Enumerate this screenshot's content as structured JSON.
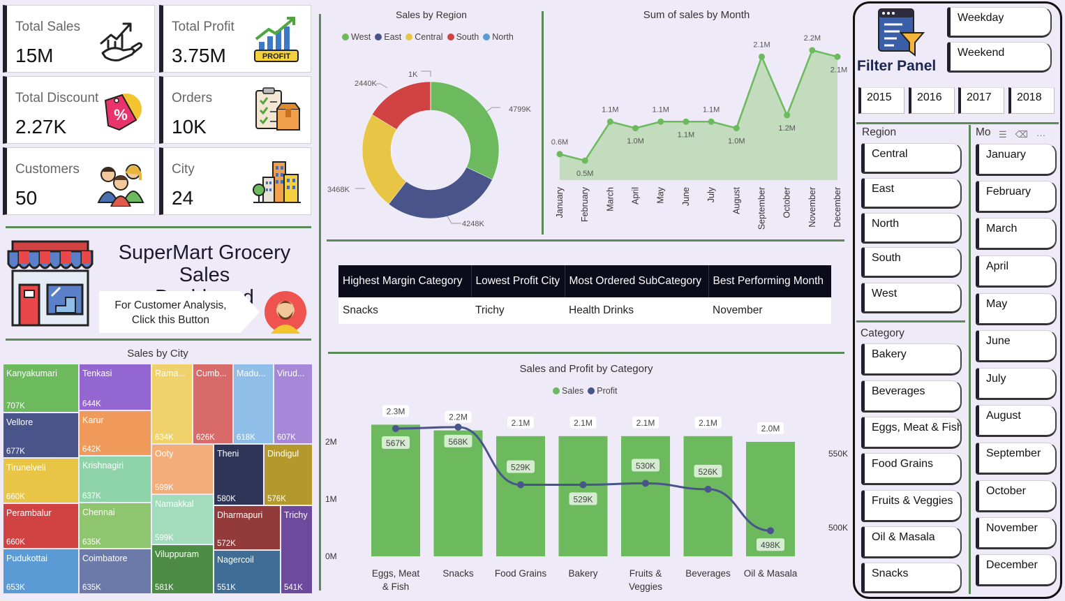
{
  "kpis": [
    {
      "label": "Total Sales",
      "value": "15M",
      "icon": "money-hand-chart-icon"
    },
    {
      "label": "Total Profit",
      "value": "3.75M",
      "icon": "profit-chart-icon"
    },
    {
      "label": "Total Discount",
      "value": "2.27K",
      "icon": "discount-tag-icon"
    },
    {
      "label": "Orders",
      "value": "10K",
      "icon": "order-box-icon"
    },
    {
      "label": "Customers",
      "value": "50",
      "icon": "customers-icon"
    },
    {
      "label": "City",
      "value": "24",
      "icon": "city-buildings-icon"
    }
  ],
  "dashboard": {
    "title_line1": "SuperMart Grocery Sales",
    "title_line2": "Dashboard",
    "customer_btn_line1": "For Customer Analysis,",
    "customer_btn_line2": "Click this Button"
  },
  "sales_by_region": {
    "title": "Sales by Region",
    "legend": [
      {
        "name": "West",
        "color": "#6cb95e"
      },
      {
        "name": "East",
        "color": "#49558a"
      },
      {
        "name": "Central",
        "color": "#e9c545"
      },
      {
        "name": "South",
        "color": "#d14343"
      },
      {
        "name": "North",
        "color": "#5b9bd5"
      }
    ],
    "labels": {
      "west": "4799K",
      "east": "4248K",
      "central": "3468K",
      "south": "2440K",
      "north": "1K"
    }
  },
  "sales_by_month": {
    "title": "Sum of sales by Month"
  },
  "kpi_table": {
    "headers": [
      "Highest Margin Category",
      "Lowest Profit City",
      "Most Ordered SubCategory",
      "Best Performing Month"
    ],
    "values": [
      "Snacks",
      "Trichy",
      "Health Drinks",
      "November"
    ]
  },
  "sales_by_city": {
    "title": "Sales by City"
  },
  "sales_profit_category": {
    "title": "Sales and Profit by Category",
    "legend": [
      {
        "name": "Sales",
        "color": "#6cb95e"
      },
      {
        "name": "Profit",
        "color": "#49558a"
      }
    ],
    "y_left_ticks": [
      "2M",
      "1M",
      "0M"
    ],
    "y_right_ticks": [
      "550K",
      "500K"
    ]
  },
  "chart_data": [
    {
      "type": "pie",
      "title": "Sales by Region",
      "categories": [
        "West",
        "East",
        "Central",
        "South",
        "North"
      ],
      "values": [
        4799,
        4248,
        3468,
        2440,
        1
      ],
      "value_labels": [
        "4799K",
        "4248K",
        "3468K",
        "2440K",
        "1K"
      ],
      "donut": true,
      "legend_position": "top"
    },
    {
      "type": "area",
      "title": "Sum of sales by Month",
      "categories": [
        "January",
        "February",
        "March",
        "April",
        "May",
        "June",
        "July",
        "August",
        "September",
        "October",
        "November",
        "December"
      ],
      "values": [
        0.6,
        0.5,
        1.1,
        1.0,
        1.1,
        1.1,
        1.1,
        1.0,
        2.1,
        1.2,
        2.2,
        2.1
      ],
      "value_labels": [
        "0.6M",
        "0.5M",
        "1.1M",
        "1.0M",
        "1.1M",
        "1.1M",
        "1.1M",
        "1.0M",
        "2.1M",
        "1.2M",
        "2.2M",
        "2.1M"
      ],
      "unit": "M"
    },
    {
      "type": "heatmap",
      "title": "Sales by City",
      "categories": [
        "Kanyakumari",
        "Vellore",
        "Tirunelveli",
        "Perambalur",
        "Pudukottai",
        "Tenkasi",
        "Karur",
        "Krishnagiri",
        "Chennai",
        "Coimbatore",
        "Rama...",
        "Cumb...",
        "Madu...",
        "Virud...",
        "Ooty",
        "Theni",
        "Dindigul",
        "Namakkal",
        "Viluppuram",
        "Dharmapuri",
        "Nagercoil",
        "Trichy"
      ],
      "values": [
        707,
        677,
        660,
        660,
        653,
        644,
        642,
        637,
        635,
        635,
        634,
        626,
        618,
        607,
        599,
        580,
        576,
        599,
        581,
        572,
        551,
        541
      ],
      "value_labels": [
        "707K",
        "677K",
        "660K",
        "660K",
        "653K",
        "644K",
        "642K",
        "637K",
        "635K",
        "635K",
        "634K",
        "626K",
        "618K",
        "607K",
        "599K",
        "580K",
        "576K",
        "599K",
        "581K",
        "572K",
        "551K",
        "541K"
      ],
      "colors": [
        "#6cb95e",
        "#49558a",
        "#e9c545",
        "#d14343",
        "#5b9bd5",
        "#9466d1",
        "#ef9a5a",
        "#8fd4a8",
        "#8fc56e",
        "#6b7aa8",
        "#efd26b",
        "#d96a6a",
        "#8fbfe8",
        "#a687d8",
        "#f2ad7a",
        "#2f3557",
        "#b3982e",
        "#a2dcbc",
        "#4c8c45",
        "#933a3a",
        "#3f6d96",
        "#6e4a9c"
      ],
      "subtype": "treemap"
    },
    {
      "type": "bar",
      "title": "Sales and Profit by Category",
      "categories": [
        "Eggs, Meat & Fish",
        "Snacks",
        "Food Grains",
        "Bakery",
        "Fruits & Veggies",
        "Beverages",
        "Oil & Masala"
      ],
      "series": [
        {
          "name": "Sales",
          "type": "bar",
          "values": [
            2.3,
            2.2,
            2.1,
            2.1,
            2.1,
            2.1,
            2.0
          ],
          "labels": [
            "2.3M",
            "2.2M",
            "2.1M",
            "2.1M",
            "2.1M",
            "2.1M",
            "2.0M"
          ],
          "unit": "M"
        },
        {
          "name": "Profit",
          "type": "line",
          "values": [
            567,
            568,
            529,
            529,
            530,
            526,
            498
          ],
          "labels": [
            "567K",
            "568K",
            "529K",
            "529K",
            "530K",
            "526K",
            "498K"
          ],
          "unit": "K"
        }
      ],
      "y_left_ticks": [
        "0M",
        "1M",
        "2M"
      ],
      "y_right_ticks": [
        "500K",
        "550K"
      ],
      "legend_position": "top"
    }
  ],
  "filter_panel": {
    "title": "Filter Panel",
    "day_type": [
      "Weekday",
      "Weekend"
    ],
    "years": [
      "2015",
      "2016",
      "2017",
      "2018"
    ],
    "region_label": "Region",
    "regions": [
      "Central",
      "East",
      "North",
      "South",
      "West"
    ],
    "category_label": "Category",
    "categories": [
      "Bakery",
      "Beverages",
      "Eggs, Meat & Fish",
      "Food Grains",
      "Fruits & Veggies",
      "Oil & Masala",
      "Snacks"
    ],
    "month_label": "Mo",
    "months": [
      "January",
      "February",
      "March",
      "April",
      "May",
      "June",
      "July",
      "August",
      "September",
      "October",
      "November",
      "December"
    ]
  }
}
